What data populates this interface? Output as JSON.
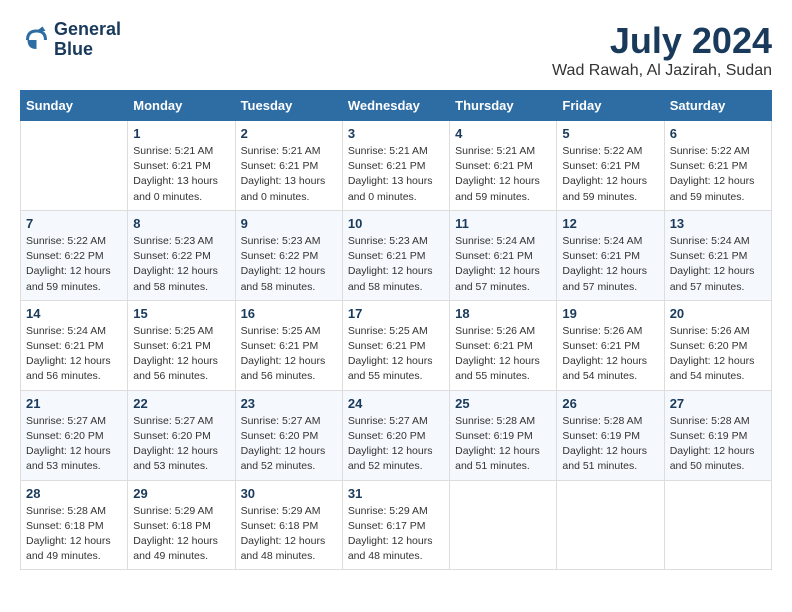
{
  "header": {
    "logo_line1": "General",
    "logo_line2": "Blue",
    "month": "July 2024",
    "location": "Wad Rawah, Al Jazirah, Sudan"
  },
  "weekdays": [
    "Sunday",
    "Monday",
    "Tuesday",
    "Wednesday",
    "Thursday",
    "Friday",
    "Saturday"
  ],
  "weeks": [
    [
      {
        "day": "",
        "info": ""
      },
      {
        "day": "1",
        "info": "Sunrise: 5:21 AM\nSunset: 6:21 PM\nDaylight: 13 hours\nand 0 minutes."
      },
      {
        "day": "2",
        "info": "Sunrise: 5:21 AM\nSunset: 6:21 PM\nDaylight: 13 hours\nand 0 minutes."
      },
      {
        "day": "3",
        "info": "Sunrise: 5:21 AM\nSunset: 6:21 PM\nDaylight: 13 hours\nand 0 minutes."
      },
      {
        "day": "4",
        "info": "Sunrise: 5:21 AM\nSunset: 6:21 PM\nDaylight: 12 hours\nand 59 minutes."
      },
      {
        "day": "5",
        "info": "Sunrise: 5:22 AM\nSunset: 6:21 PM\nDaylight: 12 hours\nand 59 minutes."
      },
      {
        "day": "6",
        "info": "Sunrise: 5:22 AM\nSunset: 6:21 PM\nDaylight: 12 hours\nand 59 minutes."
      }
    ],
    [
      {
        "day": "7",
        "info": "Sunrise: 5:22 AM\nSunset: 6:22 PM\nDaylight: 12 hours\nand 59 minutes."
      },
      {
        "day": "8",
        "info": "Sunrise: 5:23 AM\nSunset: 6:22 PM\nDaylight: 12 hours\nand 58 minutes."
      },
      {
        "day": "9",
        "info": "Sunrise: 5:23 AM\nSunset: 6:22 PM\nDaylight: 12 hours\nand 58 minutes."
      },
      {
        "day": "10",
        "info": "Sunrise: 5:23 AM\nSunset: 6:21 PM\nDaylight: 12 hours\nand 58 minutes."
      },
      {
        "day": "11",
        "info": "Sunrise: 5:24 AM\nSunset: 6:21 PM\nDaylight: 12 hours\nand 57 minutes."
      },
      {
        "day": "12",
        "info": "Sunrise: 5:24 AM\nSunset: 6:21 PM\nDaylight: 12 hours\nand 57 minutes."
      },
      {
        "day": "13",
        "info": "Sunrise: 5:24 AM\nSunset: 6:21 PM\nDaylight: 12 hours\nand 57 minutes."
      }
    ],
    [
      {
        "day": "14",
        "info": "Sunrise: 5:24 AM\nSunset: 6:21 PM\nDaylight: 12 hours\nand 56 minutes."
      },
      {
        "day": "15",
        "info": "Sunrise: 5:25 AM\nSunset: 6:21 PM\nDaylight: 12 hours\nand 56 minutes."
      },
      {
        "day": "16",
        "info": "Sunrise: 5:25 AM\nSunset: 6:21 PM\nDaylight: 12 hours\nand 56 minutes."
      },
      {
        "day": "17",
        "info": "Sunrise: 5:25 AM\nSunset: 6:21 PM\nDaylight: 12 hours\nand 55 minutes."
      },
      {
        "day": "18",
        "info": "Sunrise: 5:26 AM\nSunset: 6:21 PM\nDaylight: 12 hours\nand 55 minutes."
      },
      {
        "day": "19",
        "info": "Sunrise: 5:26 AM\nSunset: 6:21 PM\nDaylight: 12 hours\nand 54 minutes."
      },
      {
        "day": "20",
        "info": "Sunrise: 5:26 AM\nSunset: 6:20 PM\nDaylight: 12 hours\nand 54 minutes."
      }
    ],
    [
      {
        "day": "21",
        "info": "Sunrise: 5:27 AM\nSunset: 6:20 PM\nDaylight: 12 hours\nand 53 minutes."
      },
      {
        "day": "22",
        "info": "Sunrise: 5:27 AM\nSunset: 6:20 PM\nDaylight: 12 hours\nand 53 minutes."
      },
      {
        "day": "23",
        "info": "Sunrise: 5:27 AM\nSunset: 6:20 PM\nDaylight: 12 hours\nand 52 minutes."
      },
      {
        "day": "24",
        "info": "Sunrise: 5:27 AM\nSunset: 6:20 PM\nDaylight: 12 hours\nand 52 minutes."
      },
      {
        "day": "25",
        "info": "Sunrise: 5:28 AM\nSunset: 6:19 PM\nDaylight: 12 hours\nand 51 minutes."
      },
      {
        "day": "26",
        "info": "Sunrise: 5:28 AM\nSunset: 6:19 PM\nDaylight: 12 hours\nand 51 minutes."
      },
      {
        "day": "27",
        "info": "Sunrise: 5:28 AM\nSunset: 6:19 PM\nDaylight: 12 hours\nand 50 minutes."
      }
    ],
    [
      {
        "day": "28",
        "info": "Sunrise: 5:28 AM\nSunset: 6:18 PM\nDaylight: 12 hours\nand 49 minutes."
      },
      {
        "day": "29",
        "info": "Sunrise: 5:29 AM\nSunset: 6:18 PM\nDaylight: 12 hours\nand 49 minutes."
      },
      {
        "day": "30",
        "info": "Sunrise: 5:29 AM\nSunset: 6:18 PM\nDaylight: 12 hours\nand 48 minutes."
      },
      {
        "day": "31",
        "info": "Sunrise: 5:29 AM\nSunset: 6:17 PM\nDaylight: 12 hours\nand 48 minutes."
      },
      {
        "day": "",
        "info": ""
      },
      {
        "day": "",
        "info": ""
      },
      {
        "day": "",
        "info": ""
      }
    ]
  ]
}
